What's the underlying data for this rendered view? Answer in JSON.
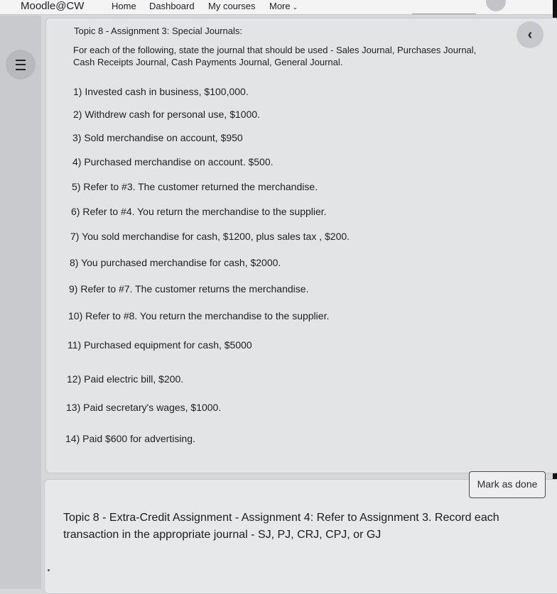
{
  "navbar": {
    "brand": "Moodle@CW",
    "links": [
      "Home",
      "Dashboard",
      "My courses"
    ],
    "more_label": "More"
  },
  "assignment": {
    "title": "Topic 8 - Assignment 3: Special Journals:",
    "instructions": "For each of the following, state the journal that should be used - Sales Journal, Purchases Journal, Cash Receipts Journal, Cash Payments Journal, General Journal.",
    "items": [
      "1) Invested cash in business, $100,000.",
      "2) Withdrew cash for personal use, $1000.",
      "3) Sold merchandise on account, $950",
      "4) Purchased merchandise on account. $500.",
      "5) Refer to #3. The customer returned the merchandise.",
      "6) Refer to #4. You return the merchandise to the supplier.",
      "7) You sold merchandise for cash, $1200, plus sales tax , $200.",
      "8) You purchased merchandise for cash, $2000.",
      "9) Refer to #7. The customer returns the merchandise.",
      "10) Refer to #8. You return the merchandise to the supplier.",
      "11) Purchased equipment for cash, $5000",
      "12) Paid electric bill, $200.",
      "13) Paid secretary's wages, $1000.",
      "14) Paid $600 for advertising."
    ]
  },
  "next_activity": {
    "mark_done_label": "Mark as done",
    "text": "Topic 8 - Extra-Credit Assignment - Assignment 4: Refer to Assignment 3. Record each transaction in the appropriate journal - SJ, PJ, CRJ, CPJ, or GJ"
  },
  "icons": {
    "drawer": "menu-icon",
    "collapse": "chevron-left-icon",
    "more": "chevron-down-icon"
  }
}
